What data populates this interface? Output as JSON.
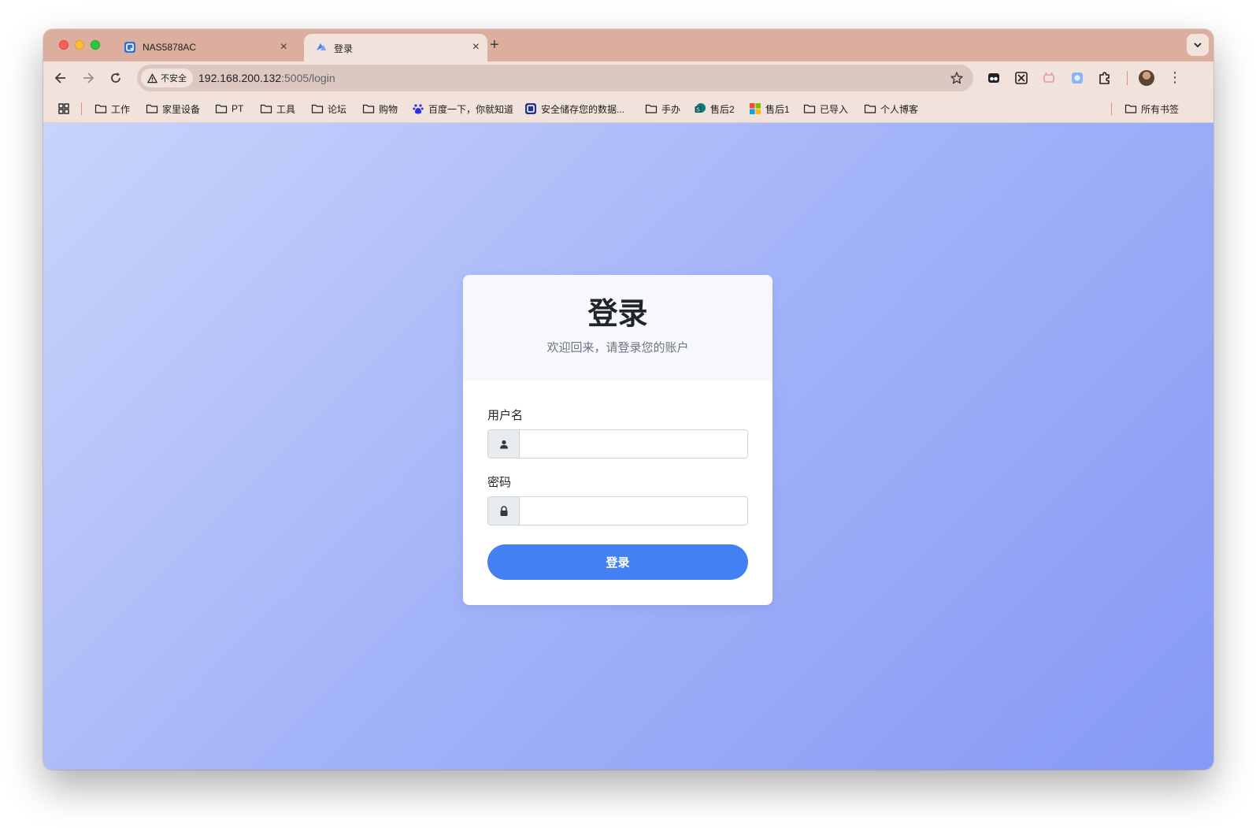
{
  "browser": {
    "tabs": [
      {
        "title": "NAS5878AC",
        "active": false
      },
      {
        "title": "登录",
        "active": true
      }
    ],
    "close_glyph": "×",
    "new_tab_glyph": "+",
    "menu_glyph": "⋮",
    "security_label": "不安全",
    "url_host": "192.168.200.132",
    "url_path": ":5005/login"
  },
  "bookmarks": [
    {
      "label": "工作",
      "icon": "folder-icon"
    },
    {
      "label": "家里设备",
      "icon": "folder-icon"
    },
    {
      "label": "PT",
      "icon": "folder-icon"
    },
    {
      "label": "工具",
      "icon": "folder-icon"
    },
    {
      "label": "论坛",
      "icon": "folder-icon"
    },
    {
      "label": "购物",
      "icon": "folder-icon"
    },
    {
      "label": "百度一下，你就知道",
      "icon": "baidu-icon"
    },
    {
      "label": "安全储存您的数据...",
      "icon": "nas-icon"
    },
    {
      "label": "手办",
      "icon": "folder-icon"
    },
    {
      "label": "售后2",
      "icon": "sharepoint-icon"
    },
    {
      "label": "售后1",
      "icon": "microsoft-icon"
    },
    {
      "label": "已导入",
      "icon": "folder-icon"
    },
    {
      "label": "个人博客",
      "icon": "folder-icon"
    },
    {
      "label": "所有书签",
      "icon": "folder-icon"
    }
  ],
  "login": {
    "title": "登录",
    "subtitle": "欢迎回来，请登录您的账户",
    "username_label": "用户名",
    "username_value": "",
    "password_label": "密码",
    "password_value": "",
    "submit_label": "登录"
  },
  "colors": {
    "accent": "#4380f3",
    "tabstrip": "#dcae9d",
    "toolbar": "#f2e2dc"
  }
}
